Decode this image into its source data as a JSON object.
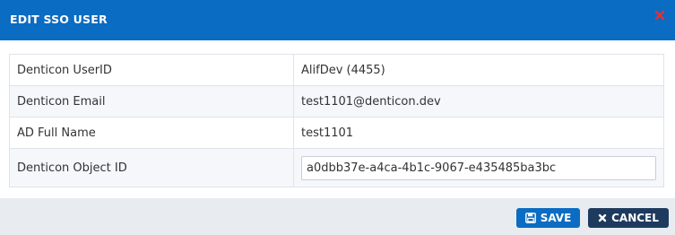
{
  "dialog": {
    "title": "EDIT SSO USER",
    "close_icon": "close-icon"
  },
  "fields": [
    {
      "label": "Denticon UserID",
      "value": "AlifDev (4455)"
    },
    {
      "label": "Denticon Email",
      "value": "test1101@denticon.dev"
    },
    {
      "label": "AD Full Name",
      "value": "test1101"
    },
    {
      "label": "Denticon Object ID",
      "value": "a0dbb37e-a4ca-4b1c-9067-e435485ba3bc"
    }
  ],
  "footer": {
    "save_label": "SAVE",
    "save_icon": "floppy-disk-icon",
    "cancel_label": "CANCEL",
    "cancel_icon": "x-icon"
  },
  "colors": {
    "header": "#0a6cc2",
    "save_button": "#0a6cc2",
    "cancel_button": "#1e3a5f",
    "close_icon": "#e0303a",
    "footer": "#e8ecf1"
  }
}
